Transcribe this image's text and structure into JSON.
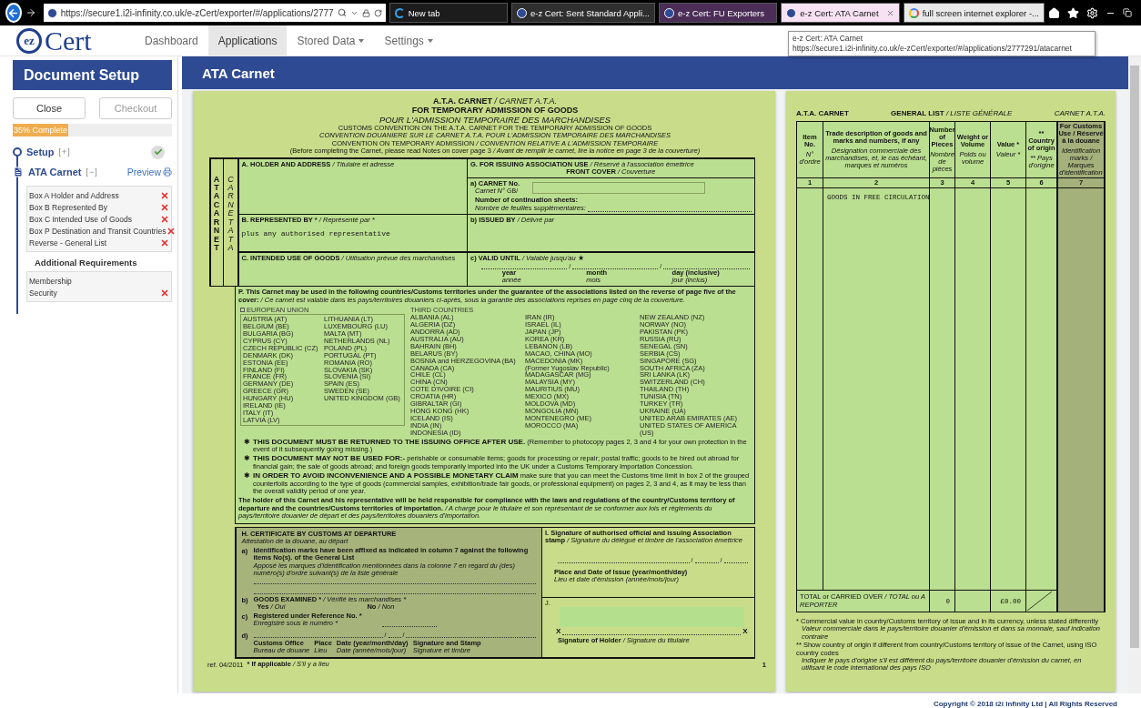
{
  "browser": {
    "address": "https://secure1.i2i-infinity.co.uk/e-zCert/exporter/#/applications/2777",
    "tabs": [
      {
        "title": "New tab",
        "kind": "edge",
        "selected": false,
        "color": "#1c1c1c"
      },
      {
        "title": "e-z Cert: Sent Standard Appli...",
        "kind": "site",
        "selected": false,
        "color": "#2f2f2f"
      },
      {
        "title": "e-z Cert: FU Exporters",
        "kind": "site",
        "selected": false,
        "color": "#4b2d57"
      },
      {
        "title": "e-z Cert: ATA Carnet",
        "kind": "site",
        "selected": true,
        "color": "#f6e2f3"
      },
      {
        "title": "full screen internet explorer -...",
        "kind": "google",
        "selected": false,
        "color": "#e9e9e9"
      }
    ],
    "tooltip": {
      "title": "e-z Cert: ATA Carnet",
      "url": "https://secure1.i2i-infinity.co.uk/e-zCert/exporter/#/applications/2777291/atacarnet"
    }
  },
  "app_nav": {
    "logo": {
      "mark": "ez",
      "text": "Cert"
    },
    "items": [
      {
        "label": "Dashboard",
        "selected": false,
        "dropdown": false
      },
      {
        "label": "Applications",
        "selected": true,
        "dropdown": false
      },
      {
        "label": "Stored Data",
        "selected": false,
        "dropdown": true
      },
      {
        "label": "Settings",
        "selected": false,
        "dropdown": true
      }
    ]
  },
  "sidebar": {
    "title": "Document Setup",
    "buttons": [
      {
        "label": "Close",
        "disabled": false
      },
      {
        "label": "Checkout",
        "disabled": true
      }
    ],
    "progress": {
      "label": "35% Complete",
      "level": 0.35
    },
    "steps": [
      {
        "title": "Setup",
        "kind": "circle",
        "toggle": "[+]",
        "expanded": false,
        "complete": true
      },
      {
        "title": "ATA Carnet",
        "kind": "document",
        "toggle": "[−]",
        "expanded": true,
        "complete": false,
        "action": "Preview",
        "items": [
          {
            "label": "Box A Holder and Address",
            "error": true
          },
          {
            "label": "Box B Represented By",
            "error": true
          },
          {
            "label": "Box C Intended Use of Goods",
            "error": true
          },
          {
            "label": "Box P Destination and Transit Countries",
            "error": true
          },
          {
            "label": "Reverse - General List",
            "error": true
          }
        ]
      }
    ],
    "additional": {
      "title": "Additional Requirements",
      "items": [
        {
          "label": "Membership",
          "error": false
        },
        {
          "label": "Security",
          "error": true
        }
      ]
    }
  },
  "main": {
    "title": "ATA Carnet"
  },
  "carnet_front": {
    "heading": [
      {
        "kind": "title",
        "en": "A.T.A. CARNET",
        "fr": "/ CARNET A.T.A."
      },
      {
        "kind": "title",
        "en": "FOR TEMPORARY ADMISSION OF GOODS"
      },
      {
        "kind": "title_fr",
        "fr": "POUR L'ADMISSION TEMPORAIRE DES MARCHANDISES"
      },
      {
        "kind": "fine",
        "en": "CUSTOMS CONVENTION ON THE A.T.A. CARNET FOR THE TEMPORARY ADMISSION OF GOODS"
      },
      {
        "kind": "fine",
        "fr": "CONVENTION DOUANIERE SUR LE CARNET A.T.A. POUR L'ADMISSION TEMPORAIRE DES MARCHANDISES"
      },
      {
        "kind": "fine",
        "en": "CONVENTION ON TEMPORARY ADMISSION",
        "fr": "/ CONVENTION RELATIVE A L'ADMISSION TEMPORAIRE"
      },
      {
        "kind": "fine",
        "en": "(Before completing the Carnet, please read Notes on cover page 3",
        "fr": "/ Avant de remplir le carnet, lire la notice en page 3 de la couverture)"
      }
    ],
    "side_en": "ATA CARNET",
    "side_fr": "CARNET ATA",
    "box_a": {
      "en": "A. HOLDER AND ADDRESS",
      "fr": "/ Titulaire et adresse"
    },
    "box_g": {
      "en": "G. FOR ISSUING ASSOCIATION USE",
      "fr": "/ Réservé à l'association émettrice"
    },
    "box_g_cover": {
      "en": "FRONT COVER",
      "fr": "/ Couverture"
    },
    "carnet_no": {
      "en": "a) CARNET No.",
      "fr": "Carnet N°",
      "prefix": "GB/"
    },
    "continuation": {
      "en": "Number of continuation sheets:",
      "fr": "Nombre de feuilles supplémentaires:"
    },
    "box_b": {
      "en": "B. REPRESENTED BY *",
      "fr": "/ Représenté par *",
      "value": "plus any authorised representative"
    },
    "issued_by": {
      "en": "b) ISSUED BY",
      "fr": "/ Délivré par"
    },
    "box_c": {
      "en": "C. INTENDED USE OF GOODS",
      "fr": "/ Utilisation prévue des marchandises"
    },
    "valid_until": {
      "en": "c) VALID UNTIL",
      "fr": "/ Valable jusqu'au",
      "mark": "★",
      "separators": [
        "/",
        "/"
      ],
      "parts": [
        {
          "en": "year",
          "fr": "année"
        },
        {
          "en": "month",
          "fr": "mois"
        },
        {
          "en": "day (inclusive)",
          "fr": "jour (inclus)"
        }
      ]
    },
    "box_p": {
      "en": "P. This Carnet may be used in the following countries/Customs territories under the guarantee of the associations listed on the reverse of page five of the cover:",
      "fr": "/ Ce carnet est valable dans les pays/territoires douaniers ci-après, sous la garantie des associations reprises en page cinq de la couverture."
    },
    "eu_label": "EUROPEAN UNION",
    "eu_columns": [
      [
        "AUSTRIA (AT)",
        "BELGIUM (BE)",
        "BULGARIA (BG)",
        "CYPRUS (CY)",
        "CZECH REPUBLIC (CZ)",
        "DENMARK (DK)",
        "ESTONIA (EE)",
        "FINLAND (FI)",
        "FRANCE (FR)",
        "GERMANY (DE)",
        "GREECE (GR)",
        "HUNGARY (HU)",
        "IRELAND (IE)",
        "ITALY (IT)",
        "LATVIA (LV)"
      ],
      [
        "LITHUANIA (LT)",
        "LUXEMBOURG (LU)",
        "MALTA (MT)",
        "NETHERLANDS (NL)",
        "POLAND (PL)",
        "PORTUGAL (PT)",
        "ROMANIA (RO)",
        "SLOVAKIA (SK)",
        "SLOVENIA (SI)",
        "SPAIN (ES)",
        "SWEDEN (SE)",
        "UNITED KINGDOM (GB)"
      ]
    ],
    "third_label": "THIRD COUNTRIES",
    "third_columns": [
      [
        "ALBANIA (AL)",
        "ALGERIA (DZ)",
        "ANDORRA (AD)",
        "AUSTRALIA (AU)",
        "BAHRAIN (BH)",
        "BELARUS (BY)",
        "BOSNIA and HERZEGOVINA (BA)",
        "CANADA (CA)",
        "CHILE (CL)",
        "CHINA (CN)",
        "COTE D'IVOIRE (CI)",
        "CROATIA (HR)",
        "GIBRALTAR (GI)",
        "HONG KONG (HK)",
        "ICELAND (IS)",
        "INDIA (IN)",
        "INDONESIA (ID)"
      ],
      [
        "IRAN (IR)",
        "ISRAEL (IL)",
        "JAPAN (JP)",
        "KOREA (KR)",
        "LEBANON (LB)",
        "MACAO, CHINA (MO)",
        "MACEDONIA (MK)",
        "(Former Yugoslav Republic)",
        "MADAGASCAR (MG)",
        "MALAYSIA (MY)",
        "MAURITIUS (MU)",
        "MEXICO (MX)",
        "MOLDOVA (MD)",
        "MONGOLIA (MN)",
        "MONTENEGRO (ME)",
        "MOROCCO (MA)"
      ],
      [
        "NEW ZEALAND (NZ)",
        "NORWAY (NO)",
        "PAKISTAN (PK)",
        "RUSSIA (RU)",
        "SENEGAL (SN)",
        "SERBIA (CS)",
        "SINGAPORE (SG)",
        "SOUTH AFRICA (ZA)",
        "SRI LANKA (LK)",
        "SWITZERLAND (CH)",
        "THAILAND (TH)",
        "TUNISIA (TN)",
        "TURKEY (TR)",
        "UKRAINE (UA)",
        "UNITED ARAB EMIRATES (AE)",
        "UNITED STATES OF AMERICA (US)"
      ]
    ],
    "notes": [
      {
        "mark": "✱",
        "title": "THIS DOCUMENT MUST BE RETURNED TO THE ISSUING OFFICE AFTER USE.",
        "body": "(Remember to photocopy pages 2, 3 and 4 for your own protection in the event of it subsequently going missing.)"
      },
      {
        "mark": "✱",
        "title": "THIS DOCUMENT MAY NOT BE USED FOR:-",
        "body": "perishable or consumable items; goods for processing or repair; postal traffic; goods to be hired out abroad for financial gain; the sale of goods abroad; and foreign goods temporarily imported into the UK under a Customs Temporary Importation Concession."
      },
      {
        "mark": "✱",
        "title": "IN ORDER TO AVOID INCONVENIENCE AND A POSSIBLE MONETARY CLAIM",
        "body": "make sure that you can meet the Customs time limit in box 2 of the grouped counterfoils according to the type of goods (commercial samples, exhibition/trade fair goods, or professional equipment) on pages 2, 3 and 4, as it may be less than the overall validity period of one year."
      }
    ],
    "liability": {
      "en": "The holder of this Carnet and his representative will be held responsible for compliance with the laws and regulations of the country/Customs territory of departure and the countries/Customs territories of importation.",
      "fr": "/ A charge pour le titulaire et son représentant de se conformer aux lois et règlements du pays/territoire douanier de départ et des pays/territoires douaniers d'importation."
    },
    "box_h": {
      "en": "H. CERTIFICATE BY CUSTOMS AT DEPARTURE",
      "fr": "Attestation de la douane, au départ"
    },
    "h_a": {
      "marker": "a)",
      "en": "Identification marks have been affixed as indicated in column 7 against the following items No(s). of the General List",
      "fr": "Apposé les marques d'identification mentionnées dans la colonne 7 en regard du (des) numéro(s) d'ordre suivant(s) de la liste générale"
    },
    "h_b": {
      "marker": "b)",
      "en": "GOODS EXAMINED *",
      "fr": "/ Vérifié les marchandises *",
      "options": [
        {
          "en": "Yes",
          "fr": "/ Oui"
        },
        {
          "en": "No",
          "fr": "/ Non"
        }
      ]
    },
    "h_c": {
      "marker": "c)",
      "en": "Registered under Reference No. *",
      "fr": "Enregistré sous le numéro *"
    },
    "h_d": {
      "marker": "d)",
      "separators": [
        "/",
        "/"
      ],
      "columns": [
        {
          "en": "Customs Office",
          "fr": "Bureau de douane"
        },
        {
          "en": "Place",
          "fr": "Lieu"
        },
        {
          "en": "Date (year/month/day)",
          "fr": "Date (année/mois/jour)"
        },
        {
          "en": "Signature and Stamp",
          "fr": "Signature et timbre"
        }
      ]
    },
    "box_i": {
      "en": "I.  Signature of authorised official and issuing Association stamp",
      "fr": "/ Signature du délégué et timbre de l'association émettrice",
      "separators": [
        "/",
        "/"
      ],
      "place_date": {
        "en": "Place and Date of Issue (year/month/day)",
        "fr": "Lieu et date d'émission (année/mois/jour)"
      }
    },
    "box_j": {
      "label": "J.",
      "marks": [
        "X",
        "X"
      ],
      "signature": {
        "en": "Signature of Holder",
        "fr": "/ Signature du titulaire"
      }
    },
    "footer": {
      "ref": "ref. 04/2011",
      "note": {
        "en": "* If applicable",
        "fr": "/ S'il y a lieu"
      },
      "page": "1"
    }
  },
  "general_list": {
    "title_left": "A.T.A. CARNET",
    "title": {
      "en": "GENERAL LIST",
      "fr": "/ LISTE GÉNÉRALE"
    },
    "title_right": "CARNET A.T.A.",
    "columns": [
      {
        "kind": "plain",
        "en": "Item No.",
        "fr": "N° d'ordre",
        "number": "1"
      },
      {
        "kind": "plain",
        "en": "Trade description of goods and marks and numbers, if any",
        "fr": "Désignation commerciale des marchandises, et, le cas échéant, marques et numéros",
        "number": "2"
      },
      {
        "kind": "plain",
        "en": "Number of Pieces",
        "fr": "Nombre de pièces",
        "number": "3"
      },
      {
        "kind": "plain",
        "en": "Weight or Volume",
        "fr": "Poids ou volume",
        "number": "4"
      },
      {
        "kind": "plain",
        "en": "Value *",
        "fr": "Valeur *",
        "number": "5"
      },
      {
        "kind": "plain",
        "en": "** Country of origin",
        "fr": "** Pays d'origine",
        "number": "6"
      },
      {
        "kind": "customs",
        "en": "For Customs Use / Réservé à la douane",
        "fr": "Identification marks / Marques d'identification",
        "number": "7"
      }
    ],
    "rows": [
      {
        "description": "GOODS IN FREE CIRCULATION"
      }
    ],
    "total": {
      "en": "TOTAL or CARRIED OVER",
      "fr": "/ TOTAL ou A REPORTER",
      "pieces": "0",
      "value": "£0.00"
    },
    "footnotes": [
      {
        "en": "* Commercial value in country/Customs territory of issue and in its currency, unless stated differently",
        "fr": "Valeur commerciale dans le pays/territoire douanier d'émission et dans sa monnaie, sauf indication contraire"
      },
      {
        "en": "** Show country of origin if different from country/Customs territory of issue of the Carnet, using ISO country codes",
        "fr": "Indiquer le pays d'origine s'il est différent du pays/territoire douanier d'émission du carnet, en utilisant le code international des pays ISO"
      }
    ]
  },
  "footer": "Copyright © 2018 i2i Infinity Ltd | All Rights Reserved"
}
